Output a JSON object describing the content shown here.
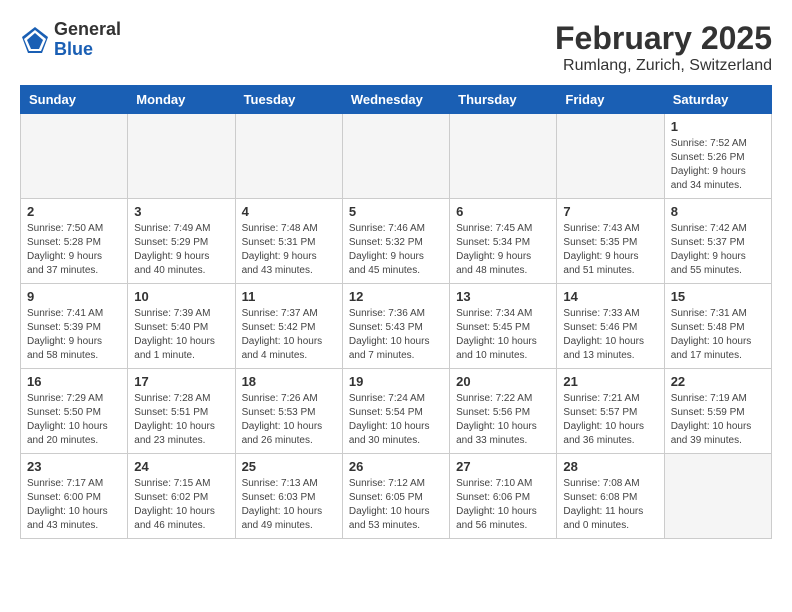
{
  "header": {
    "logo_general": "General",
    "logo_blue": "Blue",
    "title": "February 2025",
    "subtitle": "Rumlang, Zurich, Switzerland"
  },
  "weekdays": [
    "Sunday",
    "Monday",
    "Tuesday",
    "Wednesday",
    "Thursday",
    "Friday",
    "Saturday"
  ],
  "weeks": [
    [
      {
        "day": "",
        "info": ""
      },
      {
        "day": "",
        "info": ""
      },
      {
        "day": "",
        "info": ""
      },
      {
        "day": "",
        "info": ""
      },
      {
        "day": "",
        "info": ""
      },
      {
        "day": "",
        "info": ""
      },
      {
        "day": "1",
        "info": "Sunrise: 7:52 AM\nSunset: 5:26 PM\nDaylight: 9 hours\nand 34 minutes."
      }
    ],
    [
      {
        "day": "2",
        "info": "Sunrise: 7:50 AM\nSunset: 5:28 PM\nDaylight: 9 hours\nand 37 minutes."
      },
      {
        "day": "3",
        "info": "Sunrise: 7:49 AM\nSunset: 5:29 PM\nDaylight: 9 hours\nand 40 minutes."
      },
      {
        "day": "4",
        "info": "Sunrise: 7:48 AM\nSunset: 5:31 PM\nDaylight: 9 hours\nand 43 minutes."
      },
      {
        "day": "5",
        "info": "Sunrise: 7:46 AM\nSunset: 5:32 PM\nDaylight: 9 hours\nand 45 minutes."
      },
      {
        "day": "6",
        "info": "Sunrise: 7:45 AM\nSunset: 5:34 PM\nDaylight: 9 hours\nand 48 minutes."
      },
      {
        "day": "7",
        "info": "Sunrise: 7:43 AM\nSunset: 5:35 PM\nDaylight: 9 hours\nand 51 minutes."
      },
      {
        "day": "8",
        "info": "Sunrise: 7:42 AM\nSunset: 5:37 PM\nDaylight: 9 hours\nand 55 minutes."
      }
    ],
    [
      {
        "day": "9",
        "info": "Sunrise: 7:41 AM\nSunset: 5:39 PM\nDaylight: 9 hours\nand 58 minutes."
      },
      {
        "day": "10",
        "info": "Sunrise: 7:39 AM\nSunset: 5:40 PM\nDaylight: 10 hours\nand 1 minute."
      },
      {
        "day": "11",
        "info": "Sunrise: 7:37 AM\nSunset: 5:42 PM\nDaylight: 10 hours\nand 4 minutes."
      },
      {
        "day": "12",
        "info": "Sunrise: 7:36 AM\nSunset: 5:43 PM\nDaylight: 10 hours\nand 7 minutes."
      },
      {
        "day": "13",
        "info": "Sunrise: 7:34 AM\nSunset: 5:45 PM\nDaylight: 10 hours\nand 10 minutes."
      },
      {
        "day": "14",
        "info": "Sunrise: 7:33 AM\nSunset: 5:46 PM\nDaylight: 10 hours\nand 13 minutes."
      },
      {
        "day": "15",
        "info": "Sunrise: 7:31 AM\nSunset: 5:48 PM\nDaylight: 10 hours\nand 17 minutes."
      }
    ],
    [
      {
        "day": "16",
        "info": "Sunrise: 7:29 AM\nSunset: 5:50 PM\nDaylight: 10 hours\nand 20 minutes."
      },
      {
        "day": "17",
        "info": "Sunrise: 7:28 AM\nSunset: 5:51 PM\nDaylight: 10 hours\nand 23 minutes."
      },
      {
        "day": "18",
        "info": "Sunrise: 7:26 AM\nSunset: 5:53 PM\nDaylight: 10 hours\nand 26 minutes."
      },
      {
        "day": "19",
        "info": "Sunrise: 7:24 AM\nSunset: 5:54 PM\nDaylight: 10 hours\nand 30 minutes."
      },
      {
        "day": "20",
        "info": "Sunrise: 7:22 AM\nSunset: 5:56 PM\nDaylight: 10 hours\nand 33 minutes."
      },
      {
        "day": "21",
        "info": "Sunrise: 7:21 AM\nSunset: 5:57 PM\nDaylight: 10 hours\nand 36 minutes."
      },
      {
        "day": "22",
        "info": "Sunrise: 7:19 AM\nSunset: 5:59 PM\nDaylight: 10 hours\nand 39 minutes."
      }
    ],
    [
      {
        "day": "23",
        "info": "Sunrise: 7:17 AM\nSunset: 6:00 PM\nDaylight: 10 hours\nand 43 minutes."
      },
      {
        "day": "24",
        "info": "Sunrise: 7:15 AM\nSunset: 6:02 PM\nDaylight: 10 hours\nand 46 minutes."
      },
      {
        "day": "25",
        "info": "Sunrise: 7:13 AM\nSunset: 6:03 PM\nDaylight: 10 hours\nand 49 minutes."
      },
      {
        "day": "26",
        "info": "Sunrise: 7:12 AM\nSunset: 6:05 PM\nDaylight: 10 hours\nand 53 minutes."
      },
      {
        "day": "27",
        "info": "Sunrise: 7:10 AM\nSunset: 6:06 PM\nDaylight: 10 hours\nand 56 minutes."
      },
      {
        "day": "28",
        "info": "Sunrise: 7:08 AM\nSunset: 6:08 PM\nDaylight: 11 hours\nand 0 minutes."
      },
      {
        "day": "",
        "info": ""
      }
    ]
  ]
}
